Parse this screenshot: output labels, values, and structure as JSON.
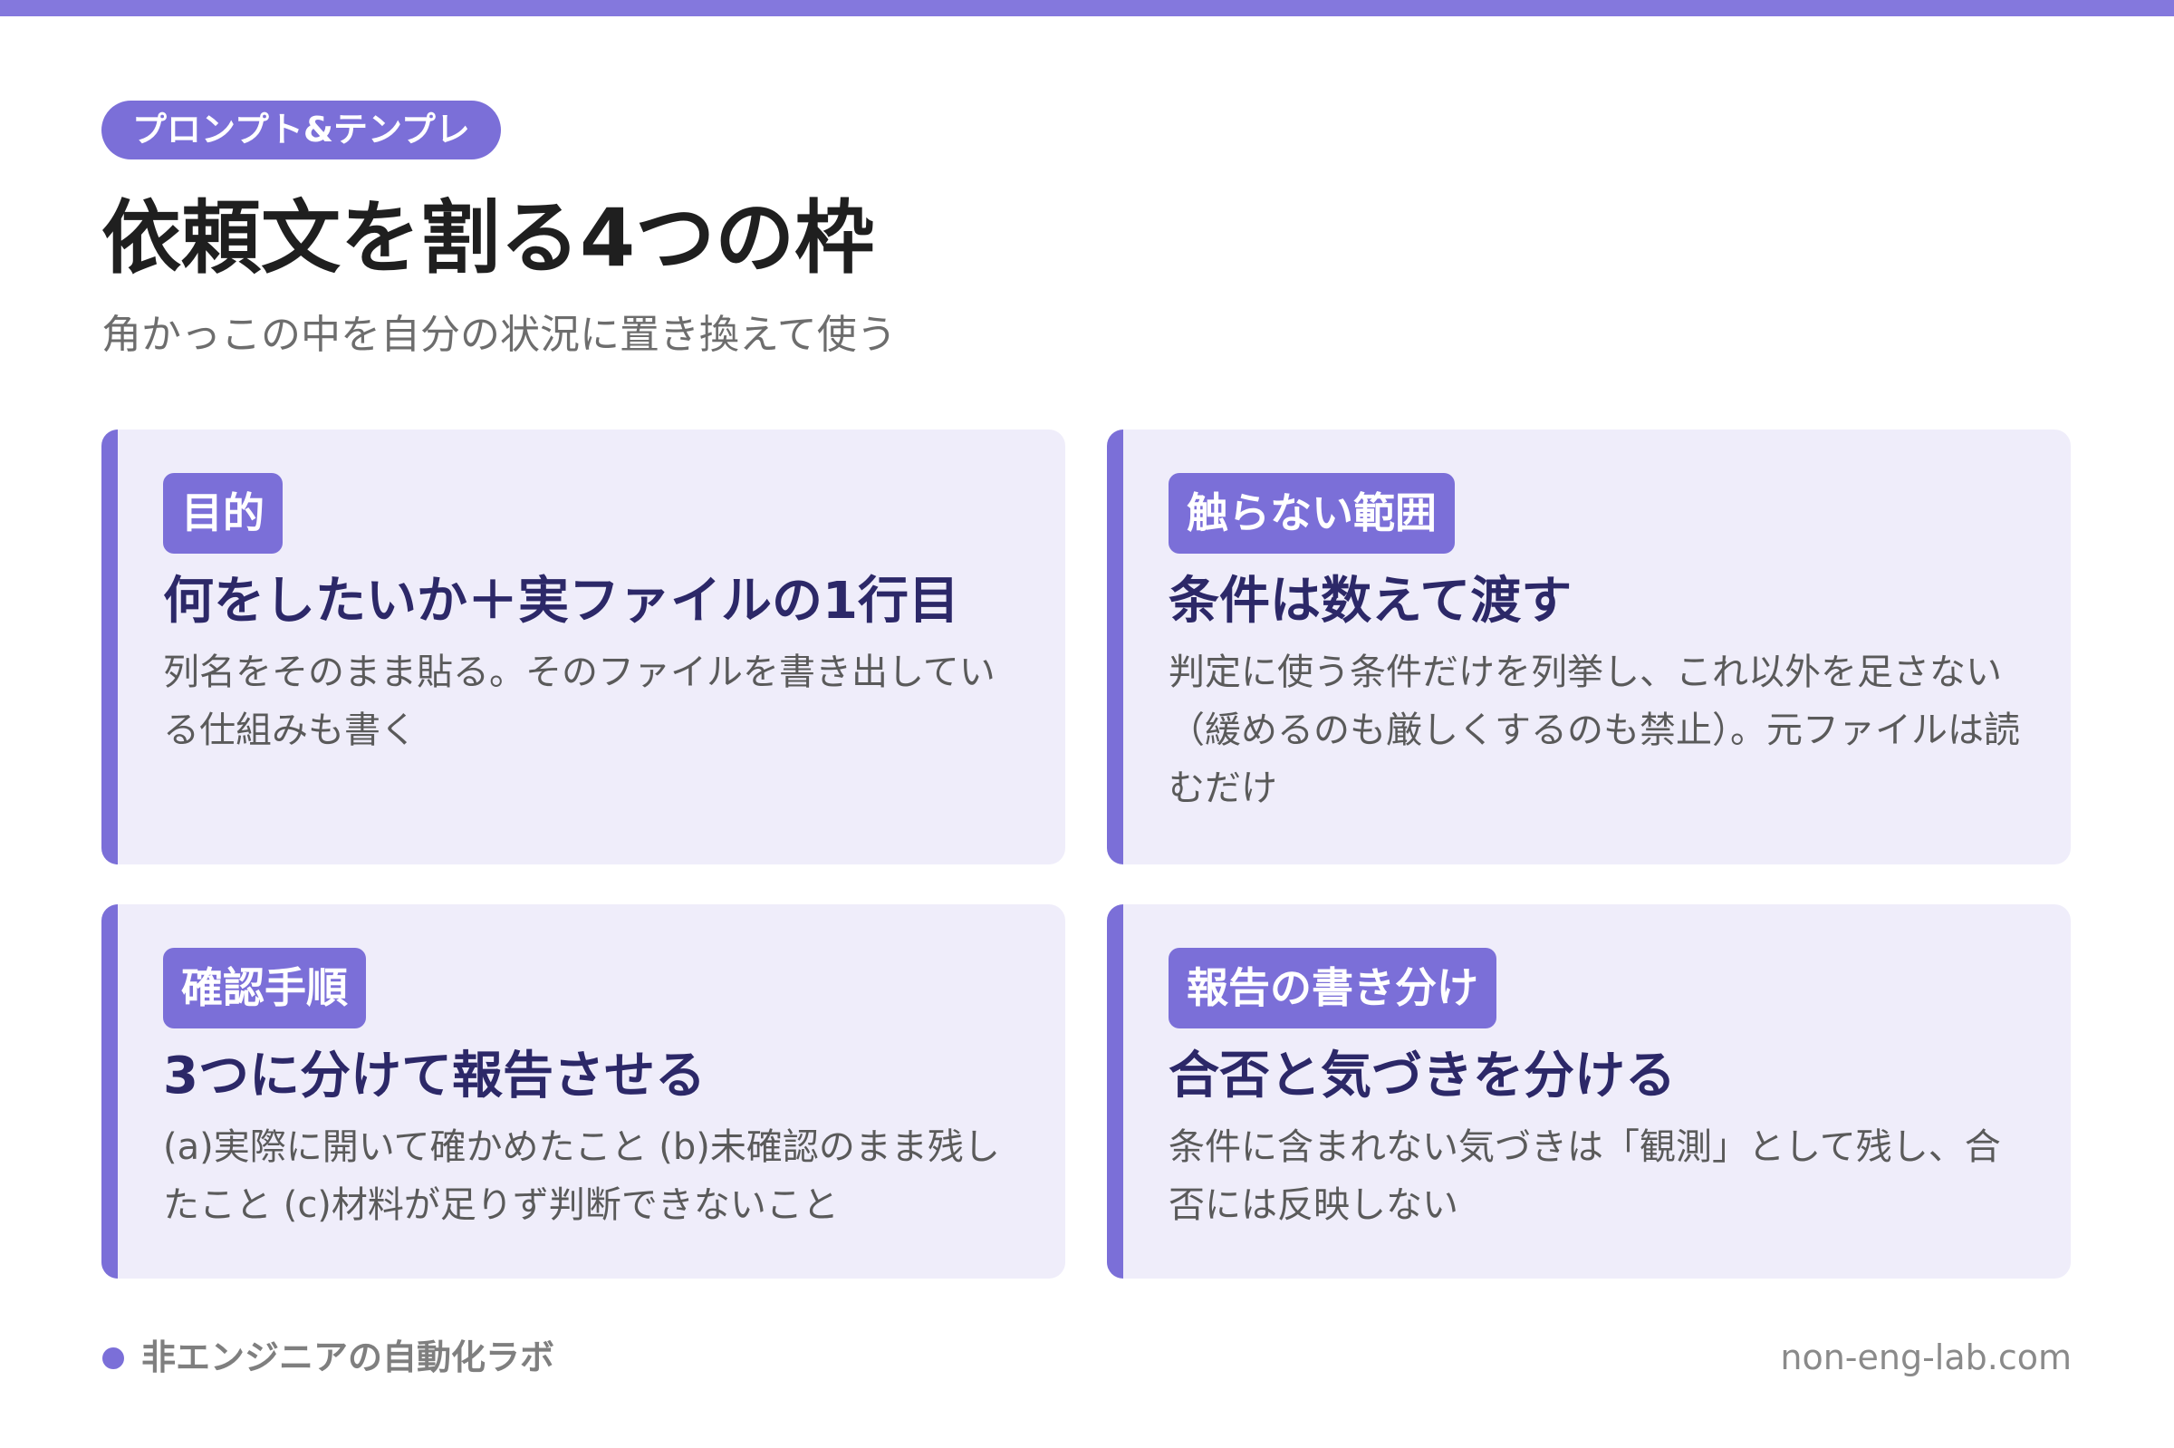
{
  "header": {
    "tag": "プロンプト&テンプレ",
    "title": "依頼文を割る4つの枠",
    "subtitle": "角かっこの中を自分の状況に置き換えて使う"
  },
  "cards": [
    {
      "badge": "目的",
      "heading": "何をしたいか＋実ファイルの1行目",
      "body": "列名をそのまま貼る。そのファイルを書き出している仕組みも書く"
    },
    {
      "badge": "触らない範囲",
      "heading": "条件は数えて渡す",
      "body": "判定に使う条件だけを列挙し、これ以外を足さない（緩めるのも厳しくするのも禁止）。元ファイルは読むだけ"
    },
    {
      "badge": "確認手順",
      "heading": "3つに分けて報告させる",
      "body": "(a)実際に開いて確かめたこと (b)未確認のまま残したこと (c)材料が足りず判断できないこと"
    },
    {
      "badge": "報告の書き分け",
      "heading": "合否と気づきを分ける",
      "body": "条件に含まれない気づきは「観測」として残し、合否には反映しない"
    }
  ],
  "footer": {
    "brand": "非エンジニアの自動化ラボ",
    "url": "non-eng-lab.com"
  },
  "colors": {
    "accent": "#7b6fd8",
    "card_background": "#efedfa",
    "heading_text": "#2c2868"
  }
}
